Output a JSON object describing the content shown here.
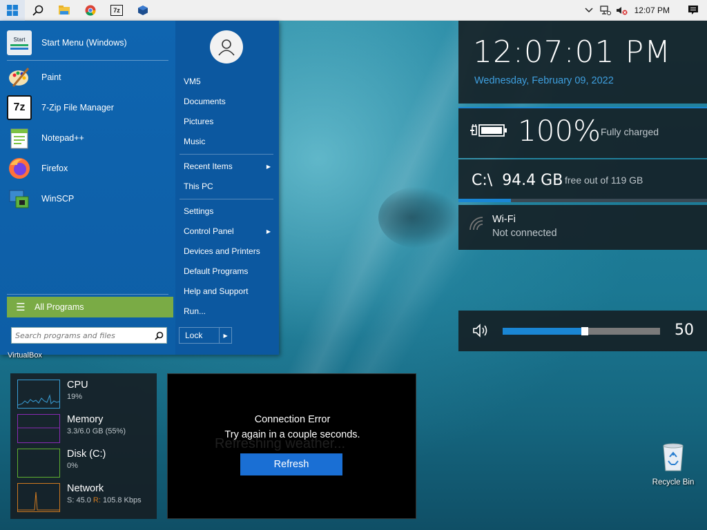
{
  "taskbar": {
    "clock": "12:07 PM",
    "buttons": [
      "windows-logo",
      "search",
      "file-explorer",
      "chrome",
      "7zip",
      "virtualbox"
    ]
  },
  "start_menu": {
    "apps": [
      {
        "label": "Start Menu (Windows)",
        "icon": "start-menu-icon"
      },
      {
        "label": "Paint",
        "icon": "paint-icon"
      },
      {
        "label": "7-Zip File Manager",
        "icon": "7zip-icon"
      },
      {
        "label": "Notepad++",
        "icon": "notepadpp-icon"
      },
      {
        "label": "Firefox",
        "icon": "firefox-icon"
      },
      {
        "label": "WinSCP",
        "icon": "winscp-icon"
      }
    ],
    "start_icon_text": "Start",
    "sevenzip_icon_text": "7z",
    "all_programs": "All Programs",
    "search_placeholder": "Search programs and files",
    "right_items": {
      "vm5": "VM5",
      "documents": "Documents",
      "pictures": "Pictures",
      "music": "Music",
      "recent_items": "Recent Items",
      "this_pc": "This PC",
      "settings": "Settings",
      "control_panel": "Control Panel",
      "devices_printers": "Devices and Printers",
      "default_programs": "Default Programs",
      "help_support": "Help and Support",
      "run": "Run..."
    },
    "lock": "Lock"
  },
  "desktop": {
    "virtualbox_label": "VirtualBox",
    "recycle_bin": "Recycle Bin"
  },
  "widgets": {
    "clock": {
      "time": "12:07:01 PM",
      "date": "Wednesday, February 09, 2022"
    },
    "battery": {
      "percent": "100%",
      "status": "Fully charged"
    },
    "disk": {
      "drive": "C:\\",
      "free": "94.4 GB",
      "total_text": "free out of 119 GB",
      "used_fraction": 0.21
    },
    "wifi": {
      "name": "Wi-Fi",
      "status": "Not connected"
    },
    "volume": {
      "value": "50",
      "level": 0.5
    }
  },
  "system_monitor": {
    "rows": [
      {
        "title": "CPU",
        "value": "19%",
        "color": "#3a9fd8"
      },
      {
        "title": "Memory",
        "value": "3.3/6.0 GB (55%)",
        "color": "#8a2ab5"
      },
      {
        "title": "Disk (C:)",
        "value": "0%",
        "color": "#5fb030"
      },
      {
        "title": "Network",
        "value_prefix": "S: 45.0 ",
        "value_r": "R:",
        "value_suffix": " 105.8 Kbps",
        "color": "#d07a20"
      }
    ]
  },
  "weather": {
    "ghost": "Refreshing weather...",
    "line1": "Connection Error",
    "line2": "Try again in a couple seconds.",
    "refresh": "Refresh"
  },
  "colors": {
    "accent": "#1a86d4",
    "start_bg": "#0e5fa8",
    "all_programs_bg": "#7aab45"
  }
}
